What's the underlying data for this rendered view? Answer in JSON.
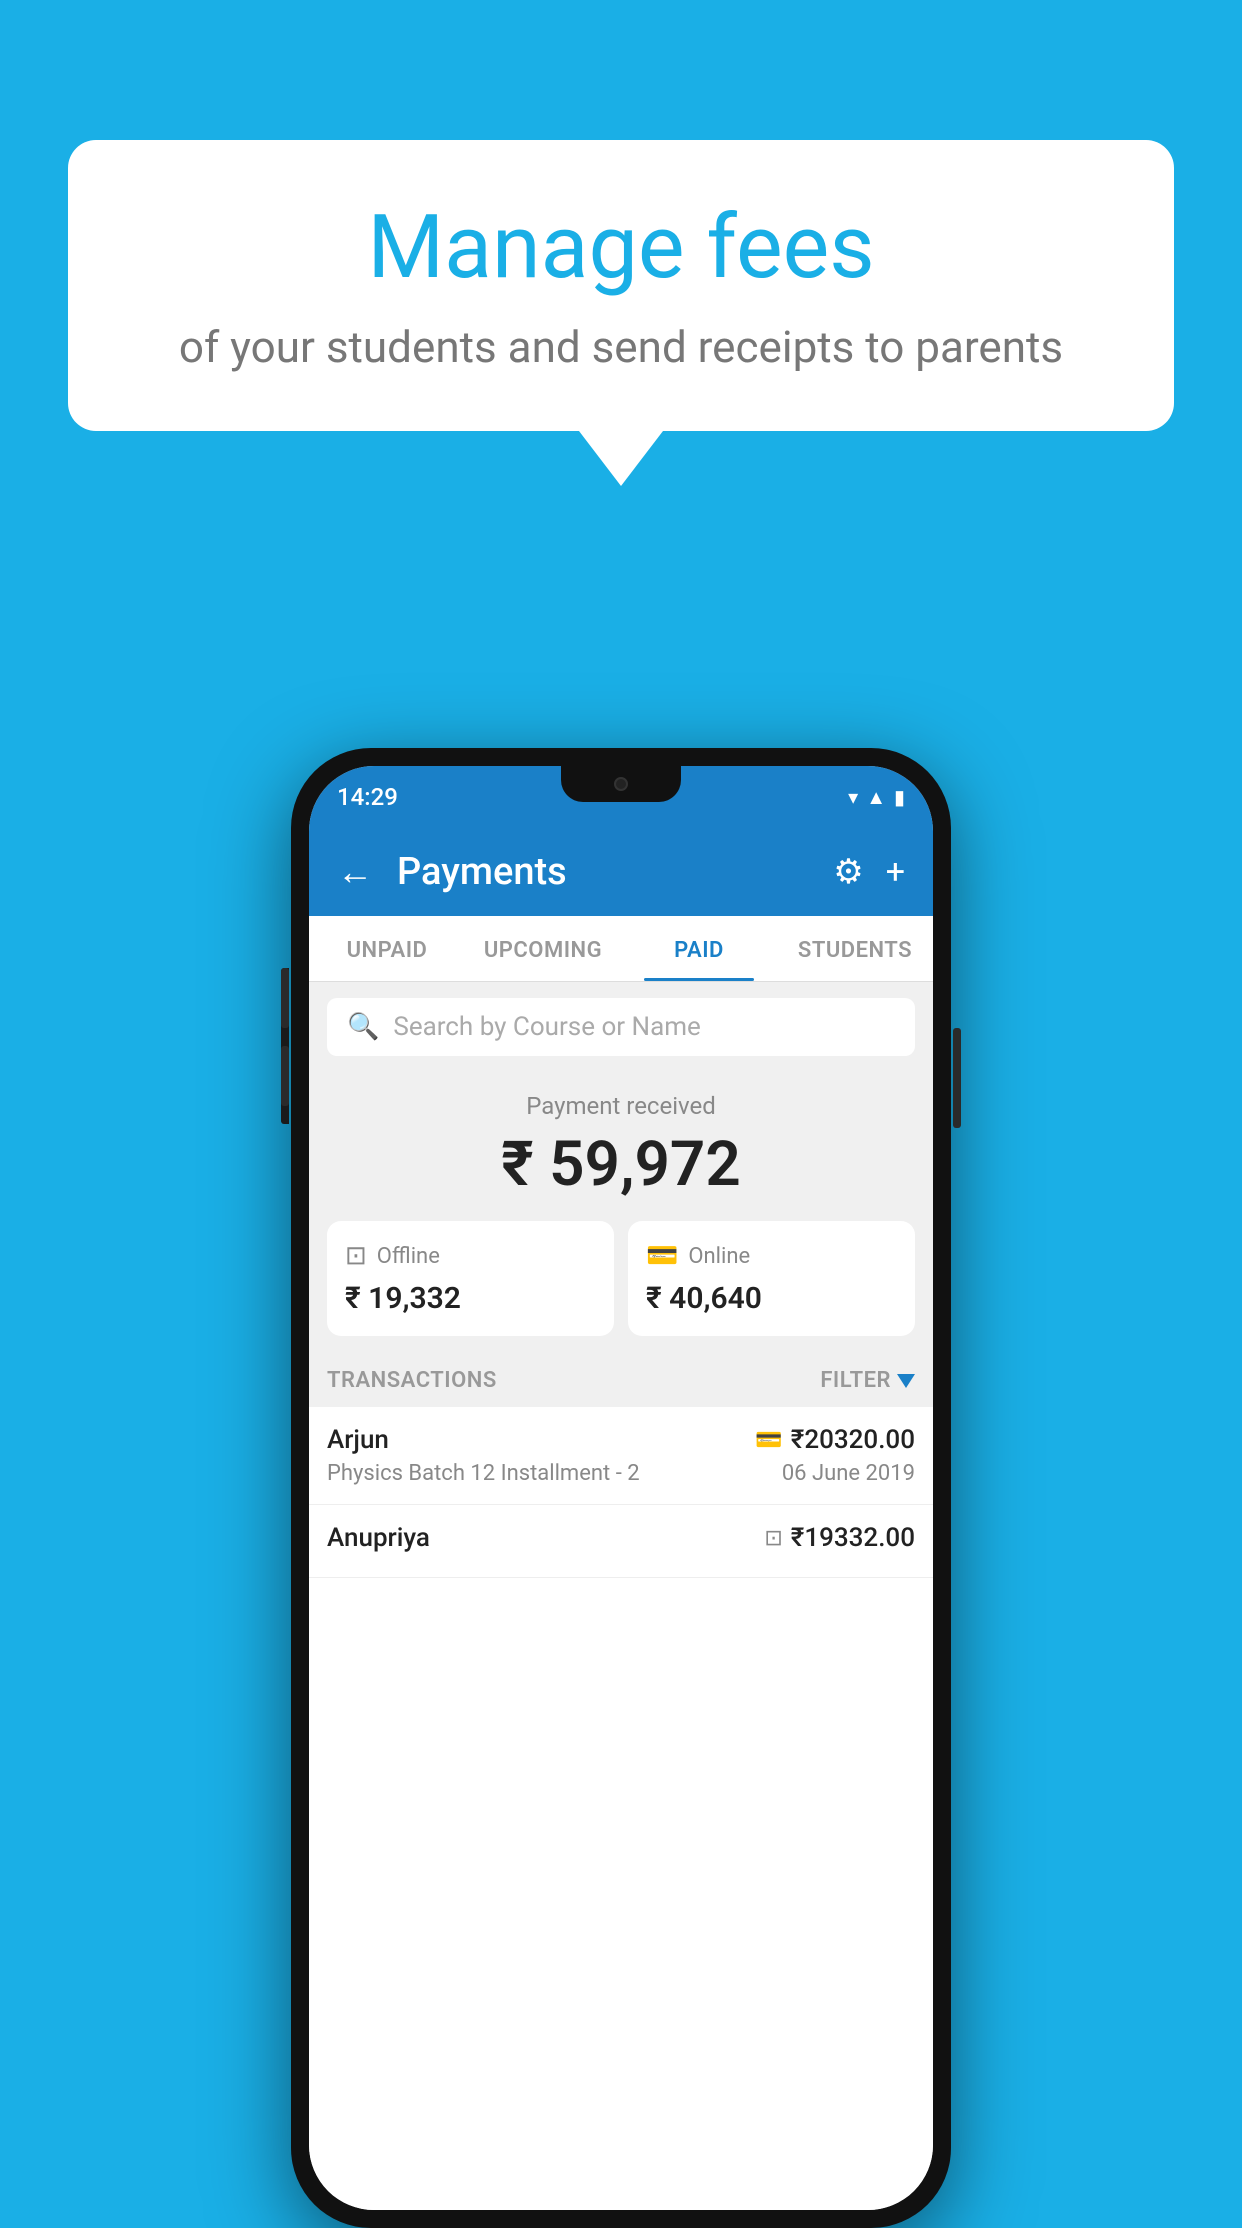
{
  "background": {
    "color": "#1AAFE6"
  },
  "speech_bubble": {
    "title": "Manage fees",
    "subtitle": "of your students and send receipts to parents"
  },
  "phone": {
    "status_bar": {
      "time": "14:29"
    },
    "header": {
      "title": "Payments",
      "back_label": "←",
      "settings_label": "⚙",
      "add_label": "+"
    },
    "tabs": [
      {
        "label": "UNPAID",
        "active": false
      },
      {
        "label": "UPCOMING",
        "active": false
      },
      {
        "label": "PAID",
        "active": true
      },
      {
        "label": "STUDENTS",
        "active": false
      }
    ],
    "search": {
      "placeholder": "Search by Course or Name"
    },
    "payment_summary": {
      "label": "Payment received",
      "amount": "₹ 59,972",
      "offline": {
        "label": "Offline",
        "amount": "₹ 19,332"
      },
      "online": {
        "label": "Online",
        "amount": "₹ 40,640"
      }
    },
    "transactions": {
      "header_label": "TRANSACTIONS",
      "filter_label": "FILTER",
      "items": [
        {
          "name": "Arjun",
          "detail": "Physics Batch 12 Installment - 2",
          "amount": "₹20320.00",
          "date": "06 June 2019",
          "payment_type": "card"
        },
        {
          "name": "Anupriya",
          "detail": "",
          "amount": "₹19332.00",
          "date": "",
          "payment_type": "offline"
        }
      ]
    }
  }
}
